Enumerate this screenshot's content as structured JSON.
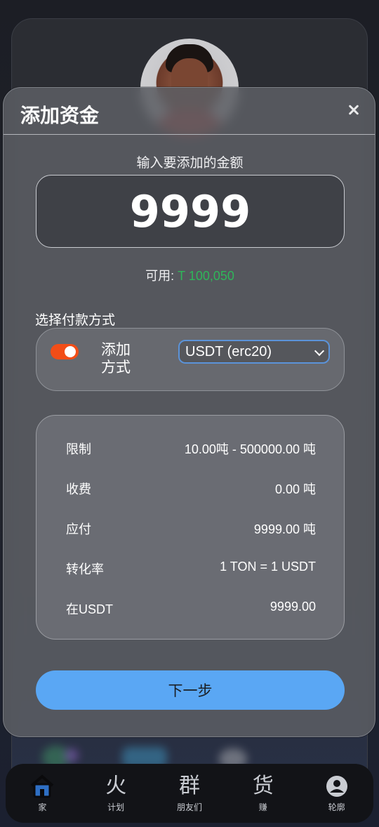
{
  "modal": {
    "title": "添加资金",
    "amount_label": "输入要添加的金额",
    "amount_value": "9999",
    "available_label": "可用:",
    "available_value": "T 100,050",
    "method_label": "选择付款方式",
    "method_name": "添加方式",
    "method_enabled": true,
    "method_select": {
      "selected": "USDT (erc20)"
    },
    "details": [
      {
        "label": "限制",
        "value": "10.00吨 - 500000.00 吨"
      },
      {
        "label": "收费",
        "value": "0.00 吨"
      },
      {
        "label": "应付",
        "value": "9999.00 吨"
      },
      {
        "label": "转化率",
        "value": "1 TON = 1 USDT"
      },
      {
        "label": "在USDT",
        "value": "9999.00"
      }
    ],
    "next_label": "下一步"
  },
  "nav": {
    "items": [
      {
        "label": "家",
        "icon": "home-icon"
      },
      {
        "label": "计划",
        "icon": "fire-glyph-icon",
        "glyph": "火"
      },
      {
        "label": "朋友们",
        "icon": "group-glyph-icon",
        "glyph": "群"
      },
      {
        "label": "赚",
        "icon": "goods-glyph-icon",
        "glyph": "货"
      },
      {
        "label": "轮廓",
        "icon": "profile-icon"
      }
    ]
  },
  "colors": {
    "accent_blue": "#5aa7f4",
    "toggle_on": "#f24d17",
    "available_green": "#2fb65a",
    "home_active": "#2e6fc4"
  }
}
